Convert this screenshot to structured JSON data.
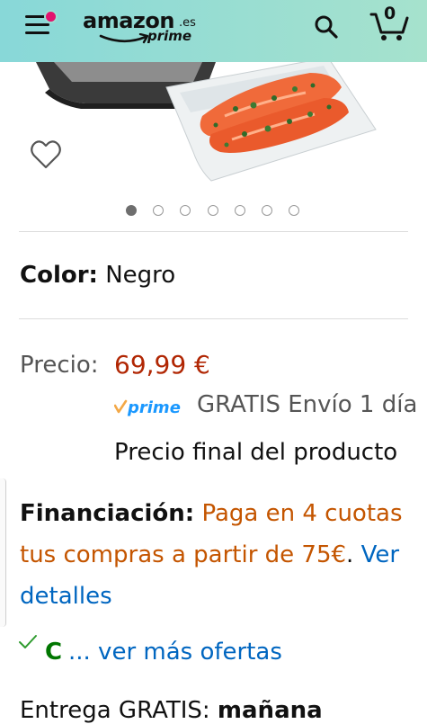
{
  "header": {
    "brand": "amazon",
    "brand_tld": ".es",
    "brand_prime": "prime",
    "cart_count": "0",
    "colors": {
      "bar_start": "#88d8d8",
      "bar_end": "#a6e2cd",
      "notification": "#e2136e"
    },
    "icons": {
      "menu": "hamburger-icon",
      "search": "search-icon",
      "cart": "cart-icon"
    }
  },
  "gallery": {
    "image_count": 7,
    "active_index": 0,
    "wishlist_icon": "heart-icon"
  },
  "product": {
    "color_key": "Color:",
    "color_value": "Negro"
  },
  "pricing": {
    "label": "Precio:",
    "value": "69,99 €",
    "prime_word": "prime",
    "shipping": "GRATIS Envío 1 día",
    "final_note": "Precio final del producto",
    "price_color": "#b12704"
  },
  "financing": {
    "key": "Financiación:",
    "offer": "Paga en 4 cuotas tus compras a partir de 75€",
    "punct": ".",
    "link": "Ver detalles"
  },
  "offers": {
    "check_icon": "checkmark-icon",
    "condition": "C",
    "more": "... ver más ofertas"
  },
  "delivery": {
    "label": "Entrega GRATIS:",
    "day": "mañana"
  }
}
